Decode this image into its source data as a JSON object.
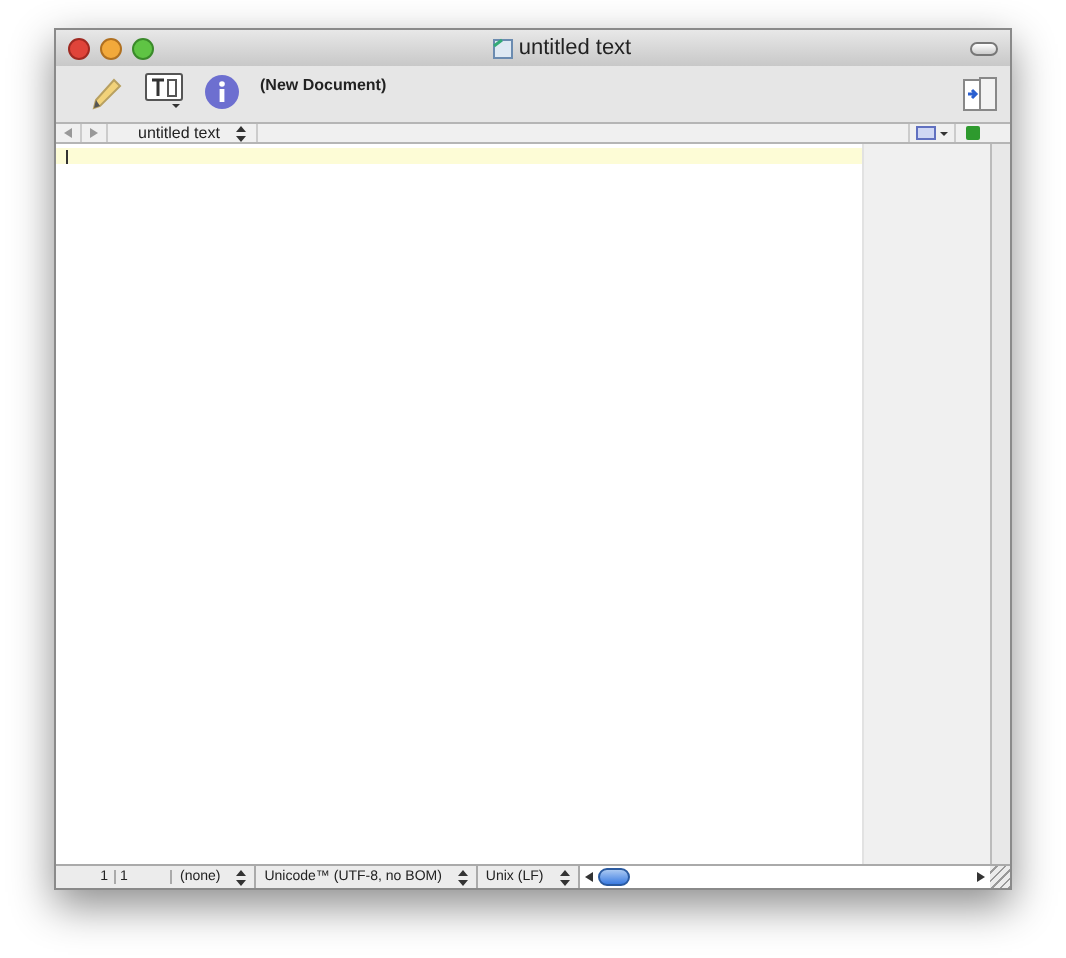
{
  "window": {
    "title": "untitled text"
  },
  "toolbar": {
    "document_status": "(New Document)"
  },
  "navigation": {
    "document_menu": "untitled text"
  },
  "status_bar": {
    "line": "1",
    "column": "1",
    "language": "(none)",
    "encoding": "Unicode™ (UTF-8, no BOM)",
    "line_endings": "Unix (LF)"
  }
}
